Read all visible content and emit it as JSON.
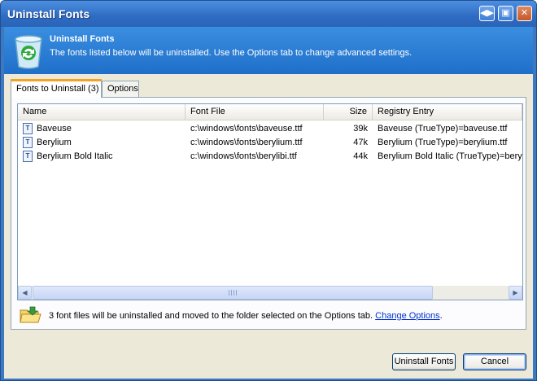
{
  "window": {
    "title": "Uninstall Fonts"
  },
  "banner": {
    "title": "Uninstall Fonts",
    "description": "The fonts listed below will be uninstalled. Use the Options tab to change advanced settings.",
    "icon": "recycle-bin-icon"
  },
  "tabs": [
    {
      "label": "Fonts to Uninstall (3)",
      "active": true
    },
    {
      "label": "Options",
      "active": false
    }
  ],
  "list": {
    "columns": [
      "Name",
      "Font File",
      "Size",
      "Registry Entry"
    ],
    "rows": [
      {
        "name": "Baveuse",
        "file": "c:\\windows\\fonts\\baveuse.ttf",
        "size": "39k",
        "registry": "Baveuse (TrueType)=baveuse.ttf"
      },
      {
        "name": "Berylium",
        "file": "c:\\windows\\fonts\\berylium.ttf",
        "size": "47k",
        "registry": "Berylium (TrueType)=berylium.ttf"
      },
      {
        "name": "Berylium Bold Italic",
        "file": "c:\\windows\\fonts\\berylibi.ttf",
        "size": "44k",
        "registry": "Berylium Bold Italic (TrueType)=berylib"
      }
    ]
  },
  "info": {
    "text": "3 font files will be uninstalled and moved to the folder selected on the Options tab.",
    "link": "Change Options",
    "trailing": "."
  },
  "buttons": {
    "uninstall": "Uninstall Fonts",
    "cancel": "Cancel"
  },
  "colors": {
    "titlebar": "#2e6bc2",
    "banner": "#1f6fc9",
    "client": "#ece9d8",
    "link": "#0033cc",
    "tab_accent": "#f5a31e"
  }
}
